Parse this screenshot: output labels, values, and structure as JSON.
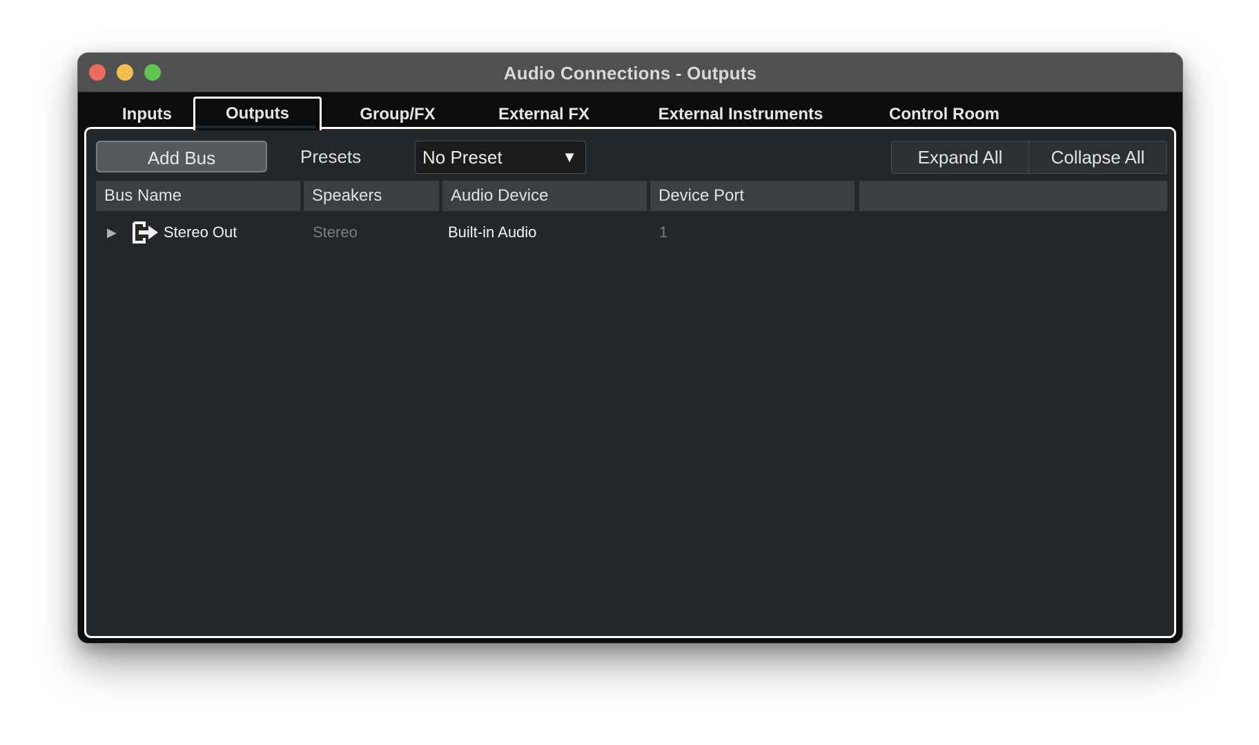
{
  "window": {
    "title": "Audio Connections - Outputs"
  },
  "tabs": [
    {
      "label": "Inputs",
      "active": false
    },
    {
      "label": "Outputs",
      "active": true
    },
    {
      "label": "Group/FX",
      "active": false
    },
    {
      "label": "External FX",
      "active": false
    },
    {
      "label": "External Instruments",
      "active": false
    },
    {
      "label": "Control Room",
      "active": false
    }
  ],
  "toolbar": {
    "add_bus_label": "Add Bus",
    "presets_label": "Presets",
    "preset_selected": "No Preset",
    "expand_all_label": "Expand All",
    "collapse_all_label": "Collapse All"
  },
  "table": {
    "columns": [
      "Bus Name",
      "Speakers",
      "Audio Device",
      "Device Port",
      ""
    ],
    "rows": [
      {
        "bus_name": "Stereo Out",
        "speakers": "Stereo",
        "audio_device": "Built-in Audio",
        "device_port": "1",
        "icon": "output-bus-icon"
      }
    ]
  },
  "colors": {
    "close": "#ed6a5e",
    "minimize": "#f4bf4f",
    "maximize": "#61c554",
    "panel_bg": "#24272a",
    "header_bg": "#3b3f43"
  }
}
